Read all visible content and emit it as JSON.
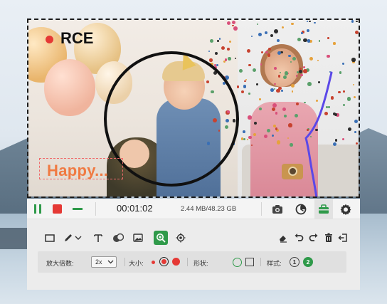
{
  "recording": {
    "annotation_label": "RCE",
    "annotation_text": "Happy..."
  },
  "control_bar": {
    "elapsed_time": "00:01:02",
    "file_size": "2.44 MB/48.23 GB"
  },
  "draw_options": {
    "zoom_label": "放大倍数:",
    "zoom_value": "2x",
    "size_label": "大小:",
    "shape_label": "形状:",
    "style_label": "样式:",
    "style_1": "1",
    "style_2": "2"
  },
  "colors": {
    "accent": "#2f9a4a",
    "record_red": "#e53935",
    "text_annotation": "#f07a42",
    "stroke_annotation": "#5b48e8"
  },
  "icons": {
    "control_bar": [
      "pause-icon",
      "stop-icon",
      "minimize-icon",
      "camera-icon",
      "timer-icon",
      "toolbox-icon",
      "gear-icon"
    ],
    "draw_tools": [
      "rectangle-icon",
      "pen-icon",
      "chevron-down-icon",
      "text-icon",
      "step-icon",
      "image-icon",
      "magnifier-icon",
      "spotlight-icon",
      "eraser-icon",
      "undo-icon",
      "redo-icon",
      "trash-icon",
      "exit-icon"
    ]
  }
}
